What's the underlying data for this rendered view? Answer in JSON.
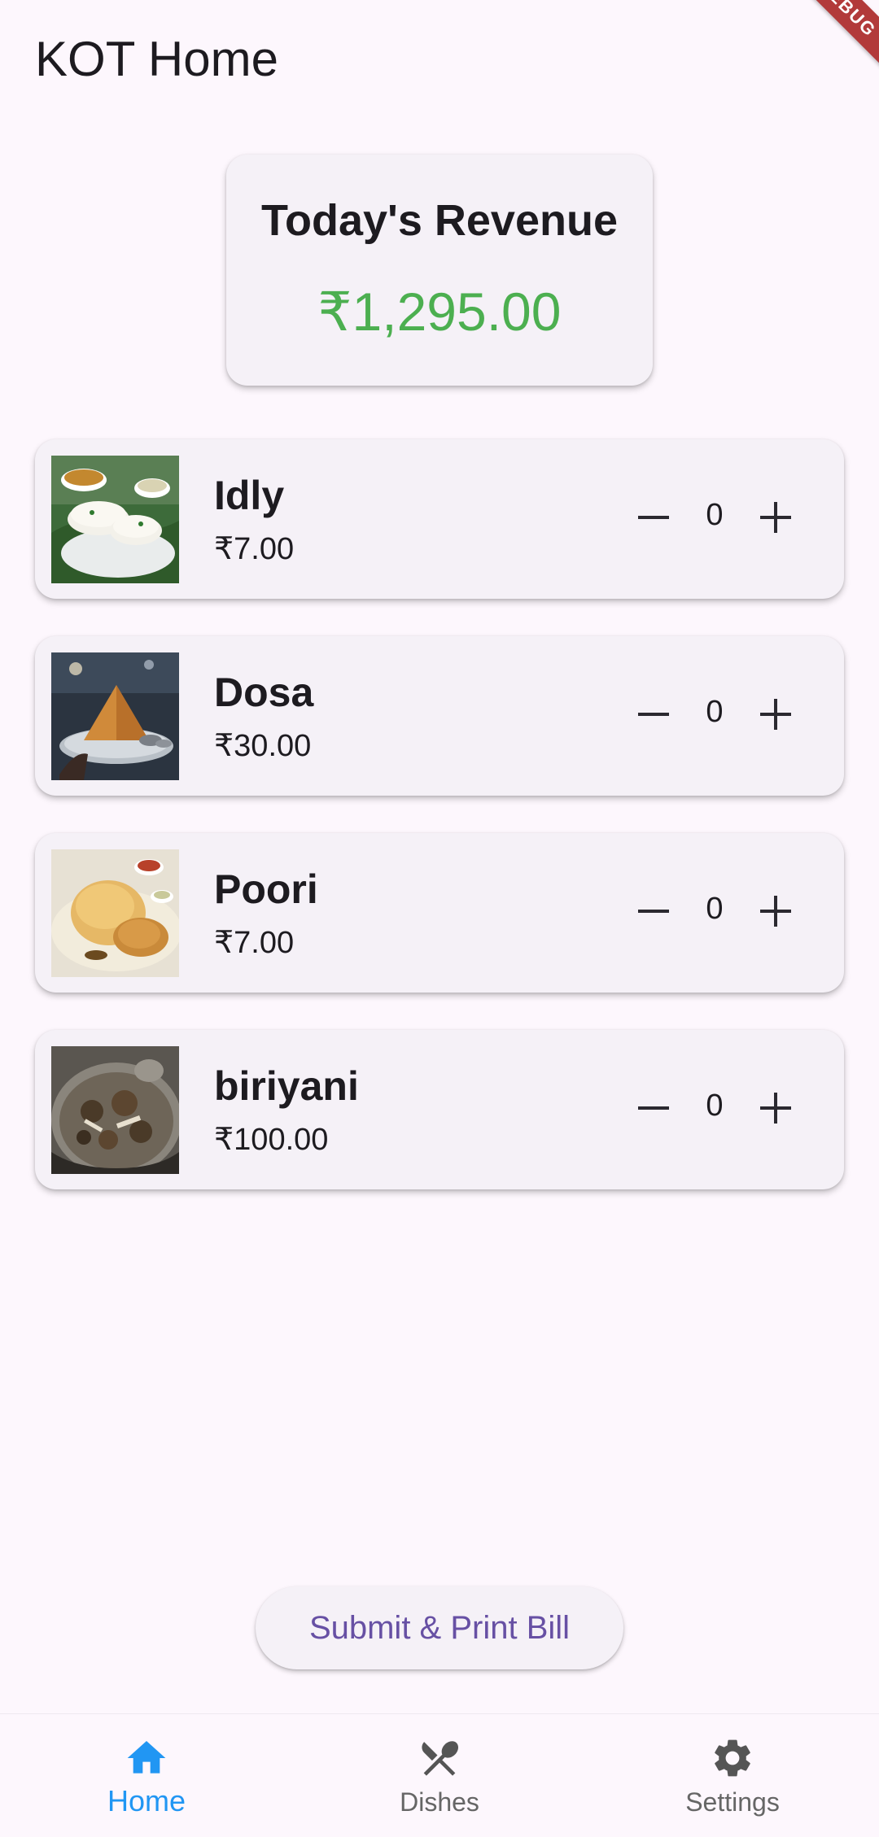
{
  "app": {
    "title": "KOT Home",
    "ribbon_text": "DEBUG"
  },
  "revenue": {
    "label": "Today's Revenue",
    "value": "₹1,295.00",
    "color": "#4caf50"
  },
  "dishes": [
    {
      "name": "Idly",
      "price": "₹7.00",
      "quantity": "0",
      "image_icon": "idly-photo"
    },
    {
      "name": "Dosa",
      "price": "₹30.00",
      "quantity": "0",
      "image_icon": "dosa-photo"
    },
    {
      "name": "Poori",
      "price": "₹7.00",
      "quantity": "0",
      "image_icon": "poori-photo"
    },
    {
      "name": "biriyani",
      "price": "₹100.00",
      "quantity": "0",
      "image_icon": "biriyani-photo"
    }
  ],
  "actions": {
    "submit_label": "Submit & Print Bill"
  },
  "bottom_nav": {
    "items": [
      {
        "label": "Home",
        "icon": "home-icon",
        "active": true
      },
      {
        "label": "Dishes",
        "icon": "fork-knife-icon",
        "active": false
      },
      {
        "label": "Settings",
        "icon": "gear-icon",
        "active": false
      }
    ],
    "active_color": "#2196f3",
    "inactive_color": "#666666"
  },
  "theme": {
    "background": "#fdf7fd",
    "card": "#f5f1f7",
    "accent": "#6750a4"
  }
}
